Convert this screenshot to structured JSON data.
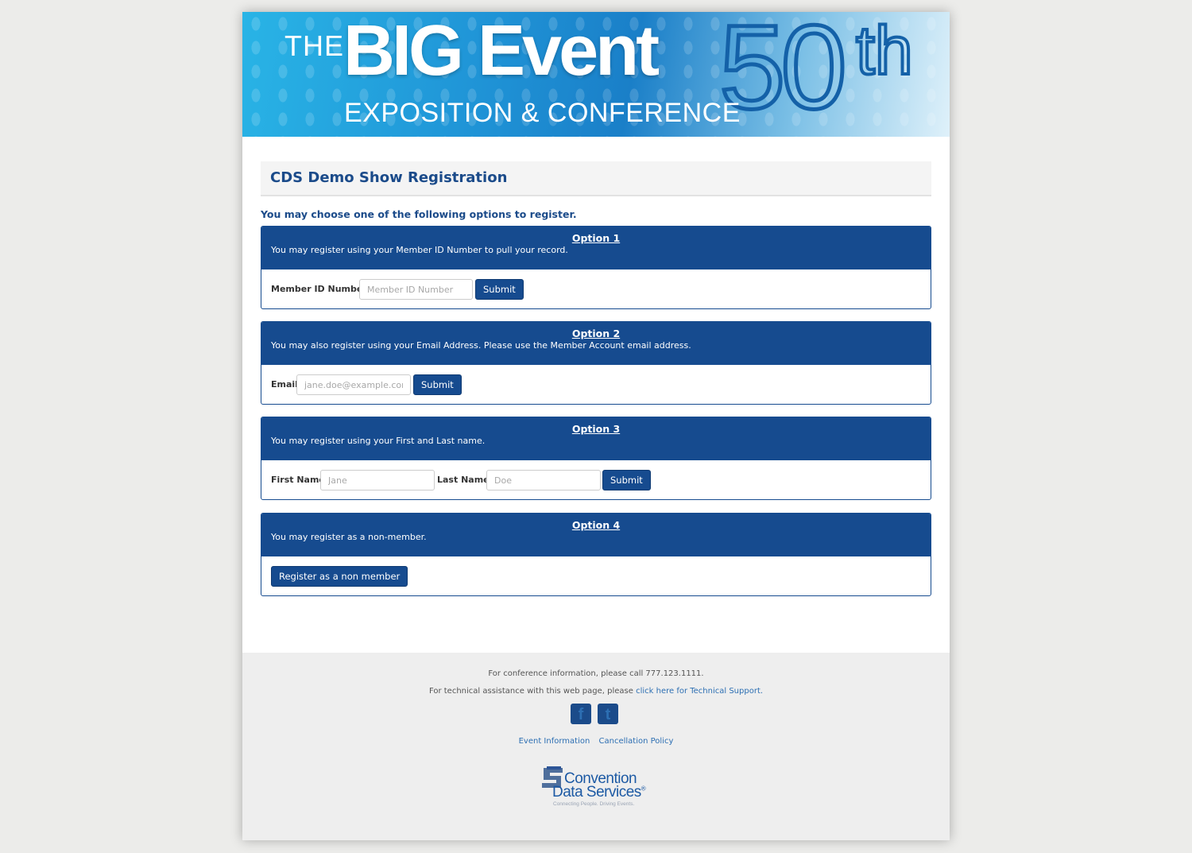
{
  "banner": {
    "the": "THE",
    "big_event": "BIG Event",
    "anniversary": "50",
    "anniversary_suffix": "th",
    "subtitle": "EXPOSITION & CONFERENCE"
  },
  "page_title": "CDS Demo Show Registration",
  "intro": "You may choose one of the following options to register.",
  "options": [
    {
      "title": "Option 1",
      "description": "You may register using your Member ID Number to pull your record.",
      "label": "Member ID Number",
      "placeholder": "Member ID Number",
      "submit": "Submit"
    },
    {
      "title": "Option 2",
      "description": "You may also register using your Email Address. Please use the Member Account email address.",
      "label": "Email",
      "placeholder": "jane.doe@example.com",
      "submit": "Submit"
    },
    {
      "title": "Option 3",
      "description": "You may register using your First and Last name.",
      "first_label": "First Name",
      "first_placeholder": "Jane",
      "last_label": "Last Name",
      "last_placeholder": "Doe",
      "submit": "Submit"
    },
    {
      "title": "Option 4",
      "description": "You may register as a non-member.",
      "button": "Register as a non member"
    }
  ],
  "footer": {
    "conference_info": "For conference information, please call 777.123.1111.",
    "tech_prefix": "For technical assistance with this web page, please",
    "tech_link": "click here for Technical Support.",
    "facebook_glyph": "f",
    "twitter_glyph": "t",
    "links": [
      "Event Information",
      "Cancellation Policy"
    ],
    "logo_line1": "Convention",
    "logo_line2": "Data Services",
    "logo_registered": "®",
    "logo_tagline": "Connecting People. Driving Events."
  },
  "colors": {
    "primary": "#164b8f",
    "title_text": "#1b4b8a",
    "link": "#2d6fb3",
    "page_bg": "#ececea",
    "footer_bg": "#eeeeee"
  }
}
